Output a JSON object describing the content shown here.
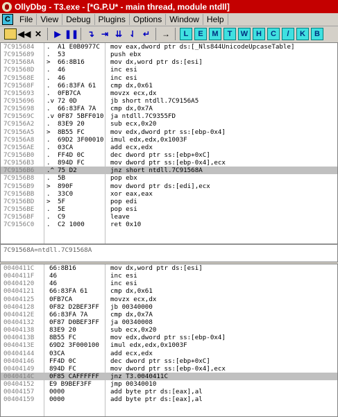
{
  "window": {
    "title": "OllyDbg - T3.exe - [*G.P.U* - main thread, module ntdll]"
  },
  "menu": {
    "items": [
      "File",
      "View",
      "Debug",
      "Plugins",
      "Options",
      "Window",
      "Help"
    ],
    "c_button": "C"
  },
  "toolbar": {
    "buttons": [
      "open-icon",
      "rewind-icon",
      "close-icon",
      "run-icon",
      "pause-icon",
      "step-into-icon",
      "step-over-icon",
      "trace-into-icon",
      "trace-over-icon",
      "execute-till-return-icon",
      "goto-icon"
    ],
    "letters": [
      "L",
      "E",
      "M",
      "T",
      "W",
      "H",
      "C",
      "/",
      "K",
      "B"
    ]
  },
  "top_pane": {
    "rows": [
      {
        "addr": "7C915684",
        "dot": ".",
        "hex": "A1 E0B0977C",
        "asm": "mov eax,dword ptr ds:[_Nls844UnicodeUpcaseTable]"
      },
      {
        "addr": "7C915689",
        "dot": ".",
        "hex": "53",
        "asm": "push ebx"
      },
      {
        "addr": "7C91568A",
        "dot": ">",
        "hex": "66:8B16",
        "asm": "mov dx,word ptr ds:[esi]"
      },
      {
        "addr": "7C91568D",
        "dot": ".",
        "hex": "46",
        "asm": "inc esi"
      },
      {
        "addr": "7C91568E",
        "dot": ".",
        "hex": "46",
        "asm": "inc esi"
      },
      {
        "addr": "7C91568F",
        "dot": ".",
        "hex": "66:83FA 61",
        "asm": "cmp dx,0x61"
      },
      {
        "addr": "7C915693",
        "dot": ".",
        "hex": "0FB7CA",
        "asm": "movzx ecx,dx"
      },
      {
        "addr": "7C915696",
        "dot": ".v",
        "hex": "72 0D",
        "asm": "jb short ntdll.7C9156A5"
      },
      {
        "addr": "7C915698",
        "dot": ".",
        "hex": "66:83FA 7A",
        "asm": "cmp dx,0x7A"
      },
      {
        "addr": "7C91569C",
        "dot": ".v",
        "hex": "0F87 5BFF010",
        "asm": "ja ntdll.7C9355FD"
      },
      {
        "addr": "7C9156A2",
        "dot": ".",
        "hex": "83E9 20",
        "asm": "sub ecx,0x20"
      },
      {
        "addr": "7C9156A5",
        "dot": ">",
        "hex": "8B55 FC",
        "asm": "mov edx,dword ptr ss:[ebp-0x4]"
      },
      {
        "addr": "7C9156A8",
        "dot": ".",
        "hex": "69D2 3F00010",
        "asm": "imul edx,edx,0x1003F"
      },
      {
        "addr": "7C9156AE",
        "dot": ".",
        "hex": "03CA",
        "asm": "add ecx,edx"
      },
      {
        "addr": "7C9156B0",
        "dot": ".",
        "hex": "FF4D 0C",
        "asm": "dec dword ptr ss:[ebp+0xC]"
      },
      {
        "addr": "7C9156B3",
        "dot": ".",
        "hex": "894D FC",
        "asm": "mov dword ptr ss:[ebp-0x4],ecx"
      },
      {
        "addr": "7C9156B6",
        "dot": ".^",
        "hex": "75 D2",
        "asm": "jnz short ntdll.7C91568A",
        "selected": true
      },
      {
        "addr": "7C9156B8",
        "dot": ".",
        "hex": "5B",
        "asm": "pop ebx"
      },
      {
        "addr": "7C9156B9",
        "dot": ">",
        "hex": "890F",
        "asm": "mov dword ptr ds:[edi],ecx"
      },
      {
        "addr": "7C9156BB",
        "dot": ".",
        "hex": "33C0",
        "asm": "xor eax,eax"
      },
      {
        "addr": "7C9156BD",
        "dot": ">",
        "hex": "5F",
        "asm": "pop edi"
      },
      {
        "addr": "7C9156BE",
        "dot": ".",
        "hex": "5E",
        "asm": "pop esi"
      },
      {
        "addr": "7C9156BF",
        "dot": ".",
        "hex": "C9",
        "asm": "leave"
      },
      {
        "addr": "7C9156C0",
        "dot": ".",
        "hex": "C2 1000",
        "asm": "ret 0x10"
      }
    ]
  },
  "info_pane": {
    "text": "7C91568A=ntdll.7C91568A"
  },
  "bottom_pane": {
    "rows": [
      {
        "addr": "0040411C",
        "hex": "66:8B16",
        "asm": "mov dx,word ptr ds:[esi]"
      },
      {
        "addr": "0040411F",
        "hex": "46",
        "asm": "inc esi"
      },
      {
        "addr": "00404120",
        "hex": "46",
        "asm": "inc esi"
      },
      {
        "addr": "00404121",
        "hex": "66:83FA 61",
        "asm": "cmp dx,0x61"
      },
      {
        "addr": "00404125",
        "hex": "0FB7CA",
        "asm": "movzx ecx,dx"
      },
      {
        "addr": "00404128",
        "hex": "0F82 D2BEF3FF",
        "asm": "jb 00340000"
      },
      {
        "addr": "0040412E",
        "hex": "66:83FA 7A",
        "asm": "cmp dx,0x7A"
      },
      {
        "addr": "00404132",
        "hex": "0F87 D0BEF3FF",
        "asm": "ja 00340008"
      },
      {
        "addr": "00404138",
        "hex": "83E9 20",
        "asm": "sub ecx,0x20"
      },
      {
        "addr": "0040413B",
        "hex": "8B55 FC",
        "asm": "mov edx,dword ptr ss:[ebp-0x4]"
      },
      {
        "addr": "0040413E",
        "hex": "69D2 3F000100",
        "asm": "imul edx,edx,0x1003F"
      },
      {
        "addr": "00404144",
        "hex": "03CA",
        "asm": "add ecx,edx"
      },
      {
        "addr": "00404146",
        "hex": "FF4D 0C",
        "asm": "dec dword ptr ss:[ebp+0xC]"
      },
      {
        "addr": "00404149",
        "hex": "894D FC",
        "asm": "mov dword ptr ss:[ebp-0x4],ecx"
      },
      {
        "addr": "0040414C",
        "hex": "0F85 CAFFFFFF",
        "asm": "jnz T3.0040411C",
        "selected": true
      },
      {
        "addr": "00404152",
        "hex": "E9 B9BEF3FF",
        "asm": "jmp 00340010"
      },
      {
        "addr": "00404157",
        "hex": "0000",
        "asm": "add byte ptr ds:[eax],al"
      },
      {
        "addr": "00404159",
        "hex": "0000",
        "asm": "add byte ptr ds:[eax],al"
      }
    ]
  }
}
